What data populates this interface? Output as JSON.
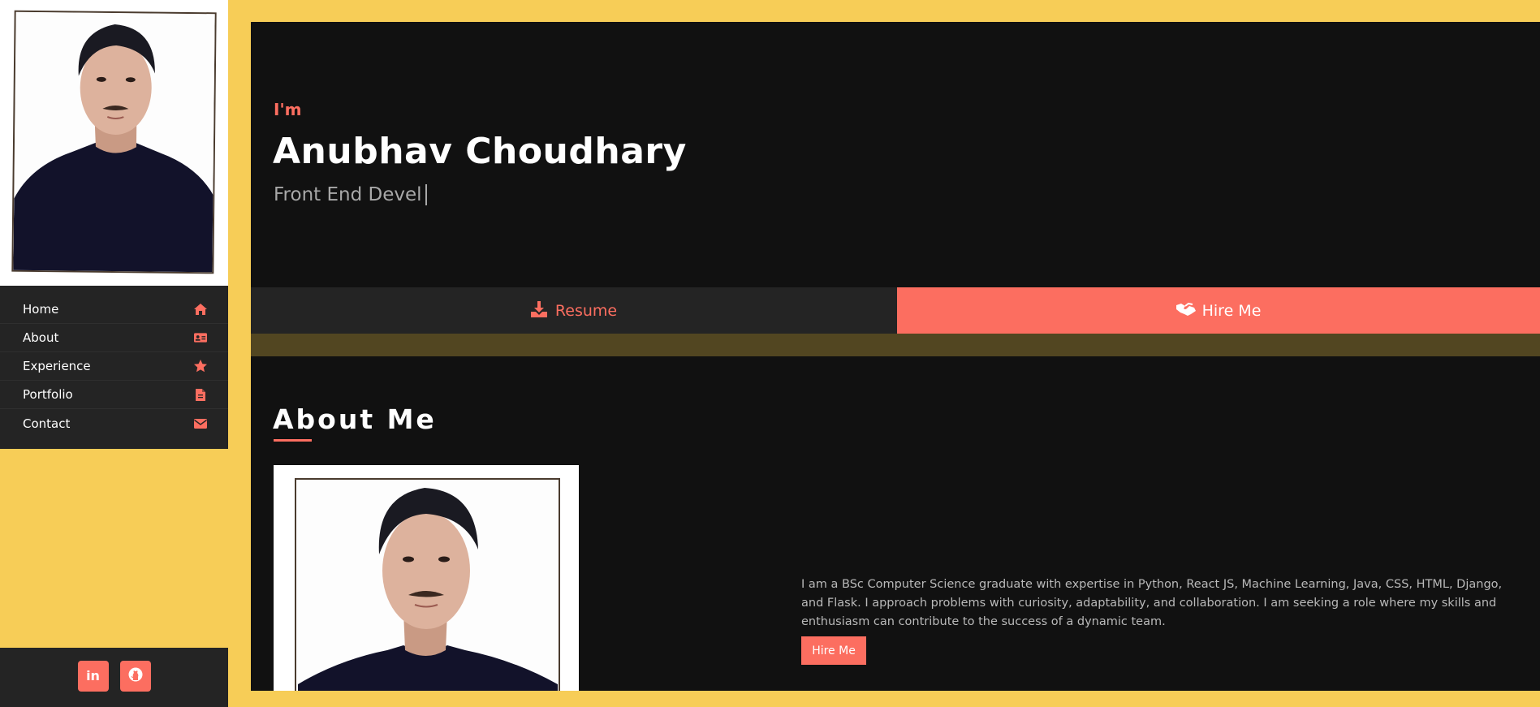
{
  "sidebar": {
    "photo_alt": "profile-photo",
    "nav": [
      {
        "label": "Home",
        "icon": "home-icon"
      },
      {
        "label": "About",
        "icon": "id-card-icon"
      },
      {
        "label": "Experience",
        "icon": "star-icon"
      },
      {
        "label": "Portfolio",
        "icon": "file-icon"
      },
      {
        "label": "Contact",
        "icon": "envelope-icon"
      }
    ],
    "social": [
      {
        "icon": "linkedin-icon",
        "text": "in"
      },
      {
        "icon": "github-icon"
      }
    ]
  },
  "hero": {
    "greeting": "I'm",
    "name": "Anubhav Choudhary",
    "role": "Front End Devel"
  },
  "buttons": {
    "resume_label": "Resume",
    "resume_icon": "download-icon",
    "hire_label": "Hire Me",
    "hire_icon": "handshake-icon"
  },
  "about": {
    "title": "About Me",
    "text": "I am a BSc Computer Science graduate with expertise in Python, React JS, Machine Learning, Java, CSS, HTML, Django, and Flask. I approach problems with curiosity, adaptability, and collaboration. I am seeking a role where my skills and enthusiasm can contribute to the success of a dynamic team.",
    "hire_label": "Hire Me"
  },
  "colors": {
    "accent": "#fc6e60",
    "background": "#f7cd57",
    "panel": "#111111",
    "sidebar": "#242424",
    "band": "#524621"
  }
}
